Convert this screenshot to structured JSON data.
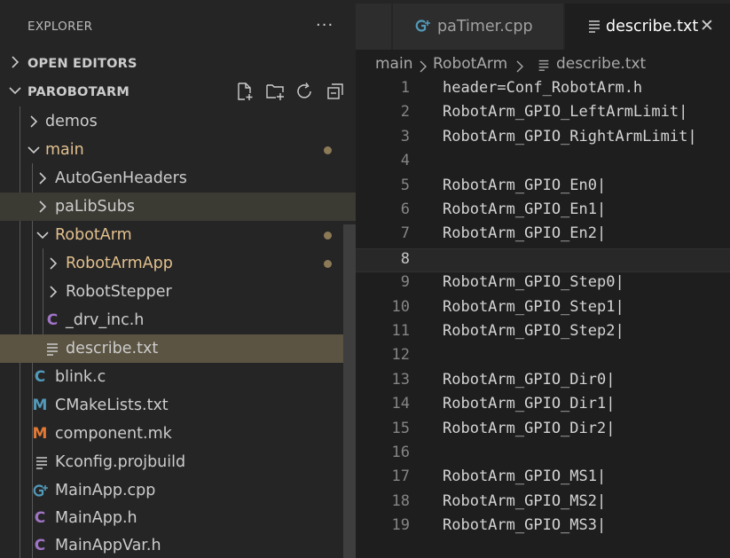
{
  "sidebar": {
    "title": "EXPLORER",
    "more_label": "···",
    "open_editors_label": "OPEN EDITORS",
    "project_label": "PAROBOTARM",
    "actions": [
      "new-file-icon",
      "new-folder-icon",
      "refresh-icon",
      "collapse-all-icon"
    ]
  },
  "tree": [
    {
      "name": "demos",
      "type": "folder",
      "expanded": false,
      "modified": false
    },
    {
      "name": "main",
      "type": "folder",
      "expanded": true,
      "modified": true
    },
    {
      "name": "AutoGenHeaders",
      "type": "folder",
      "expanded": false,
      "modified": false
    },
    {
      "name": "paLibSubs",
      "type": "folder",
      "expanded": false,
      "modified": false
    },
    {
      "name": "RobotArm",
      "type": "folder",
      "expanded": true,
      "modified": true
    },
    {
      "name": "RobotArmApp",
      "type": "folder",
      "expanded": false,
      "modified": true
    },
    {
      "name": "RobotStepper",
      "type": "folder",
      "expanded": false,
      "modified": false
    },
    {
      "name": "_drv_inc.h",
      "type": "file",
      "icon": "c-header-icon",
      "icon_glyph": "C",
      "icon_color": "#a074c4"
    },
    {
      "name": "describe.txt",
      "type": "file",
      "icon": "text-file-icon",
      "icon_color": "#cccccc"
    },
    {
      "name": "blink.c",
      "type": "file",
      "icon": "c-file-icon",
      "icon_glyph": "C",
      "icon_color": "#519aba"
    },
    {
      "name": "CMakeLists.txt",
      "type": "file",
      "icon": "cmake-icon",
      "icon_glyph": "M",
      "icon_color": "#519aba"
    },
    {
      "name": "component.mk",
      "type": "file",
      "icon": "makefile-icon",
      "icon_glyph": "M",
      "icon_color": "#e37933"
    },
    {
      "name": "Kconfig.projbuild",
      "type": "file",
      "icon": "text-file-icon",
      "icon_color": "#cccccc"
    },
    {
      "name": "MainApp.cpp",
      "type": "file",
      "icon": "cpp-file-icon",
      "icon_glyph": "G+",
      "icon_color": "#519aba"
    },
    {
      "name": "MainApp.h",
      "type": "file",
      "icon": "c-header-icon",
      "icon_glyph": "C",
      "icon_color": "#a074c4"
    },
    {
      "name": "MainAppVar.h",
      "type": "file",
      "icon": "c-header-icon",
      "icon_glyph": "C",
      "icon_color": "#a074c4"
    }
  ],
  "tabs": [
    {
      "label": "paTimer.cpp",
      "icon": "cpp-file-icon",
      "active": false
    },
    {
      "label": "describe.txt",
      "icon": "text-file-icon",
      "active": true,
      "close": "✕"
    }
  ],
  "breadcrumb": {
    "parts": [
      "main",
      "RobotArm",
      "describe.txt"
    ]
  },
  "editor": {
    "current_line": 8,
    "lines": [
      "header=Conf_RobotArm.h",
      "RobotArm_GPIO_LeftArmLimit|",
      "RobotArm_GPIO_RightArmLimit|",
      "",
      "RobotArm_GPIO_En0|",
      "RobotArm_GPIO_En1|",
      "RobotArm_GPIO_En2|",
      "",
      "RobotArm_GPIO_Step0|",
      "RobotArm_GPIO_Step1|",
      "RobotArm_GPIO_Step2|",
      "",
      "RobotArm_GPIO_Dir0|",
      "RobotArm_GPIO_Dir1|",
      "RobotArm_GPIO_Dir2|",
      "",
      "RobotArm_GPIO_MS1|",
      "RobotArm_GPIO_MS2|",
      "RobotArm_GPIO_MS3|"
    ]
  },
  "colors": {
    "modified": "#e2c08d",
    "modified_dot": "#8c7a56",
    "active_row": "#5b5442"
  }
}
